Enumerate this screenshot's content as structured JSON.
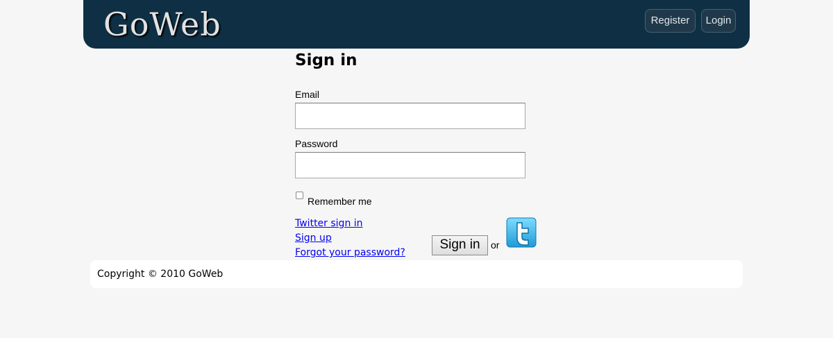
{
  "header": {
    "logo_text": "GoWeb",
    "nav": {
      "register_label": "Register",
      "login_label": "Login"
    },
    "background_color": "#0f3044"
  },
  "signin": {
    "title": "Sign in",
    "email": {
      "label": "Email",
      "value": "",
      "placeholder": ""
    },
    "password": {
      "label": "Password",
      "value": "",
      "placeholder": ""
    },
    "remember_me": {
      "label": "Remember me",
      "checked": false
    },
    "links": {
      "twitter_signin": "Twitter sign in",
      "signup": "Sign up",
      "forgot_password": "Forgot your password?"
    },
    "submit_label": "Sign in",
    "or_text": "or",
    "twitter_icon": "twitter-bird-icon"
  },
  "footer": {
    "copyright": "Copyright © 2010 GoWeb"
  }
}
